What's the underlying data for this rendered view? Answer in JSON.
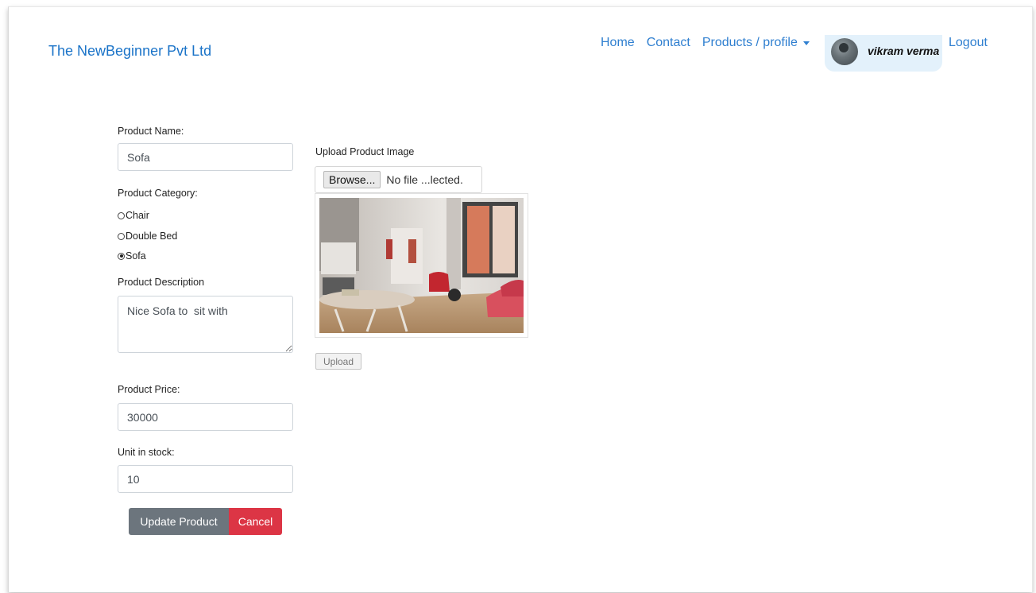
{
  "header": {
    "brand": "The NewBeginner Pvt Ltd",
    "nav": {
      "home": "Home",
      "contact": "Contact",
      "products_profile": "Products / profile",
      "logout": "Logout"
    },
    "user": {
      "name": "vikram verma"
    }
  },
  "form": {
    "product_name": {
      "label": "Product Name:",
      "value": "Sofa"
    },
    "category": {
      "label": "Product Category:",
      "options": [
        {
          "label": "Chair",
          "checked": false
        },
        {
          "label": "Double Bed",
          "checked": false
        },
        {
          "label": "Sofa",
          "checked": true
        }
      ]
    },
    "description": {
      "label": "Product Description",
      "value": "Nice Sofa to  sit with"
    },
    "price": {
      "label": "Product Price:",
      "value": "30000"
    },
    "stock": {
      "label": "Unit in stock:",
      "value": "10"
    },
    "update_label": "Update Product",
    "cancel_label": "Cancel"
  },
  "upload": {
    "label": "Upload Product Image",
    "browse_label": "Browse...",
    "file_status": "No file ...lected.",
    "upload_label": "Upload"
  },
  "colors": {
    "link": "#2f7fd0",
    "brand": "#1a73c8",
    "update_button": "#6c757d",
    "cancel_button": "#dc3545",
    "profile_bg": "#e3f1fb"
  }
}
